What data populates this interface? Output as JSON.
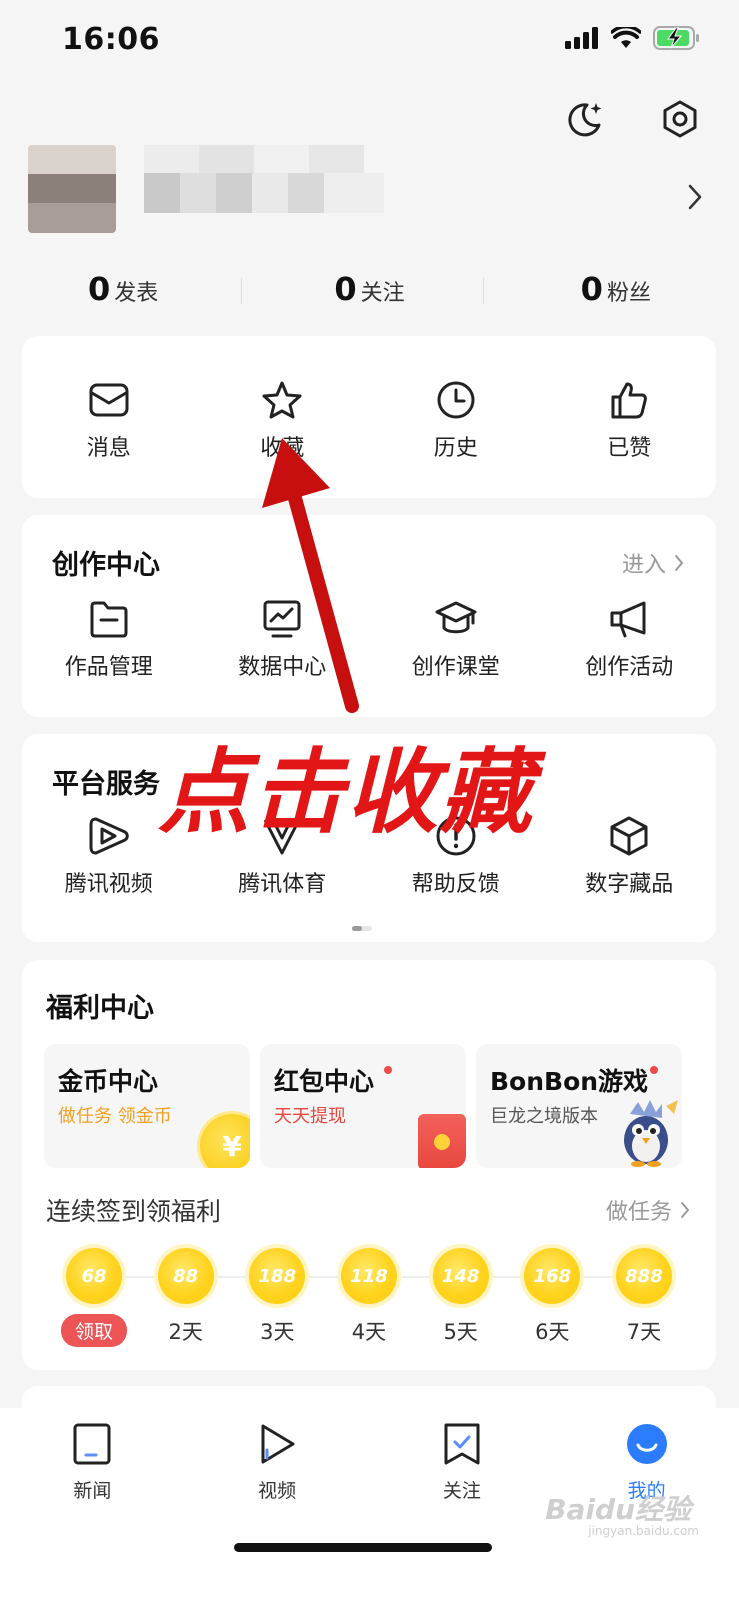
{
  "status_bar": {
    "time": "16:06"
  },
  "stats": [
    {
      "count": "0",
      "label": "发表"
    },
    {
      "count": "0",
      "label": "关注"
    },
    {
      "count": "0",
      "label": "粉丝"
    }
  ],
  "shortcuts": [
    {
      "label": "消息",
      "icon": "mail-icon"
    },
    {
      "label": "收藏",
      "icon": "star-icon"
    },
    {
      "label": "历史",
      "icon": "clock-icon"
    },
    {
      "label": "已赞",
      "icon": "thumbs-up-icon"
    }
  ],
  "creation": {
    "title": "创作中心",
    "enter_label": "进入",
    "items": [
      {
        "label": "作品管理",
        "icon": "folder-icon"
      },
      {
        "label": "数据中心",
        "icon": "chart-monitor-icon"
      },
      {
        "label": "创作课堂",
        "icon": "graduation-cap-icon"
      },
      {
        "label": "创作活动",
        "icon": "megaphone-icon"
      }
    ]
  },
  "services": {
    "title": "平台服务",
    "items": [
      {
        "label": "腾讯视频",
        "icon": "tencent-video-icon"
      },
      {
        "label": "腾讯体育",
        "icon": "tencent-sports-icon"
      },
      {
        "label": "帮助反馈",
        "icon": "help-feedback-icon"
      },
      {
        "label": "数字藏品",
        "icon": "cube-icon"
      }
    ]
  },
  "welfare": {
    "title": "福利中心",
    "tiles": [
      {
        "title": "金币中心",
        "subtitle": "做任务 领金币",
        "subtitle_color": "#f0a020",
        "coin_symbol": "¥"
      },
      {
        "title": "红包中心",
        "subtitle": "天天提现",
        "subtitle_color": "#e8473f"
      },
      {
        "title": "BonBon游戏",
        "subtitle": "巨龙之境版本",
        "subtitle_color": "#555555"
      }
    ],
    "checkin_title": "连续签到领福利",
    "task_label": "做任务",
    "days": [
      {
        "coins": "68",
        "label": "领取"
      },
      {
        "coins": "88",
        "label": "2天"
      },
      {
        "coins": "188",
        "label": "3天"
      },
      {
        "coins": "118",
        "label": "4天"
      },
      {
        "coins": "148",
        "label": "5天"
      },
      {
        "coins": "168",
        "label": "6天"
      },
      {
        "coins": "888",
        "label": "7天"
      }
    ]
  },
  "tabbar": [
    {
      "label": "新闻",
      "icon": "news-icon",
      "active": false
    },
    {
      "label": "视频",
      "icon": "play-icon",
      "active": false
    },
    {
      "label": "关注",
      "icon": "bookmark-check-icon",
      "active": false
    },
    {
      "label": "我的",
      "icon": "profile-smile-icon",
      "active": true
    }
  ],
  "annotation": {
    "text": "点击收藏"
  },
  "watermark": {
    "brand": "Baidu经验",
    "url": "jingyan.baidu.com"
  },
  "colors": {
    "accent": "#2b7cff",
    "annotation": "#e21616",
    "claim": "#ec5455"
  }
}
